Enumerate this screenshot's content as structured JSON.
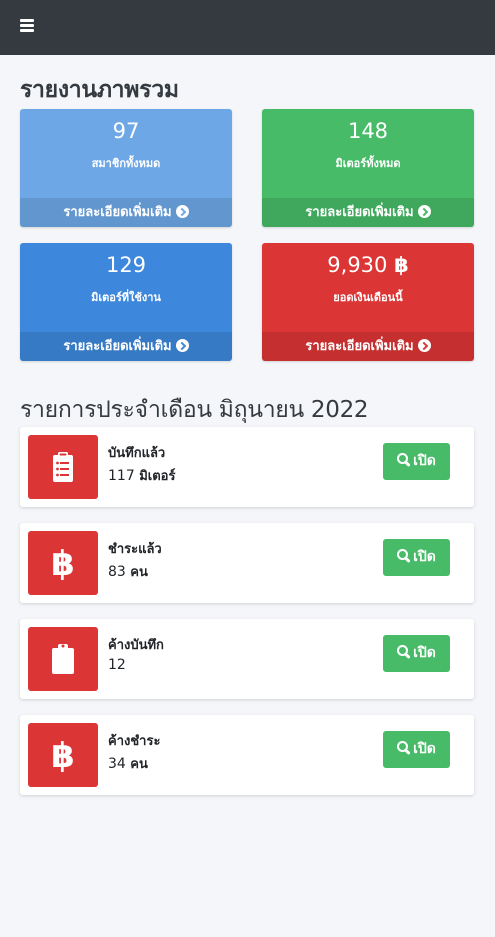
{
  "navbar": {
    "menu_icon": "bars-icon"
  },
  "overview": {
    "title": "รายงานภาพรวม",
    "boxes": [
      {
        "value": "97",
        "label": "สมาชิกทั้งหมด",
        "link": "รายละเอียดเพิ่มเติม",
        "color": "#6ea7e6"
      },
      {
        "value": "148",
        "label": "มิเตอร์ทั้งหมด",
        "link": "รายละเอียดเพิ่มเติม",
        "color": "#48bb68"
      },
      {
        "value": "129",
        "label": "มิเตอร์ที่ใช้งาน",
        "link": "รายละเอียดเพิ่มเติม",
        "color": "#3d87dc"
      },
      {
        "value": "9,930",
        "currency_symbol": "฿",
        "label": "ยอดเงินเดือนนี้",
        "link": "รายละเอียดเพิ่มเติม",
        "color": "#dc3535"
      }
    ]
  },
  "monthly": {
    "title": "รายการประจำเดือน มิถุนายน 2022",
    "items": [
      {
        "icon": "clipboard-list-icon",
        "title": "บันทึกแล้ว",
        "value": "117",
        "unit": "มิเตอร์",
        "button": "เปิด"
      },
      {
        "icon": "bitcoin-icon",
        "title": "ชำระแล้ว",
        "value": "83",
        "unit": "คน",
        "button": "เปิด"
      },
      {
        "icon": "clipboard-icon",
        "title": "ค้างบันทึก",
        "value": "12",
        "unit": "",
        "button": "เปิด"
      },
      {
        "icon": "bitcoin-icon",
        "title": "ค้างชำระ",
        "value": "34",
        "unit": "คน",
        "button": "เปิด"
      }
    ]
  },
  "colors": {
    "navbar": "#343a40",
    "danger": "#dc3535",
    "success": "#48bb68",
    "primary": "#3d87dc",
    "info": "#6ea7e6"
  }
}
